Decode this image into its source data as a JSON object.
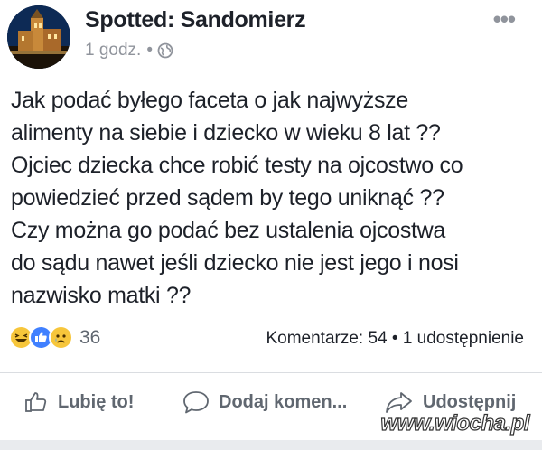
{
  "header": {
    "page_name": "Spotted: Sandomierz",
    "time": "1 godz.",
    "separator": "•",
    "more_label": "•••"
  },
  "post": {
    "text": "Jak podać byłego faceta o jak najwyższe\nalimenty na siebie i dziecko w wieku 8 lat ??\nOjciec dziecka chce robić testy na ojcostwo co\npowiedzieć przed sądem by tego uniknąć ??\nCzy można go podać bez ustalenia ojcostwa\ndo sądu nawet jeśli dziecko nie jest jego i nosi\nnazwisko matki ??"
  },
  "stats": {
    "reaction_count": "36",
    "comments_shares": "Komentarze: 54 • 1 udostępnienie",
    "reactions": [
      "haha-icon",
      "like-icon",
      "sad-icon"
    ]
  },
  "actions": {
    "like": "Lubię to!",
    "comment": "Dodaj komen...",
    "share": "Udostępnij"
  },
  "watermark": "www.wiocha.pl",
  "colors": {
    "like_blue": "#4080ff",
    "emoji_yellow": "#f7c63b",
    "muted": "#90949c"
  }
}
